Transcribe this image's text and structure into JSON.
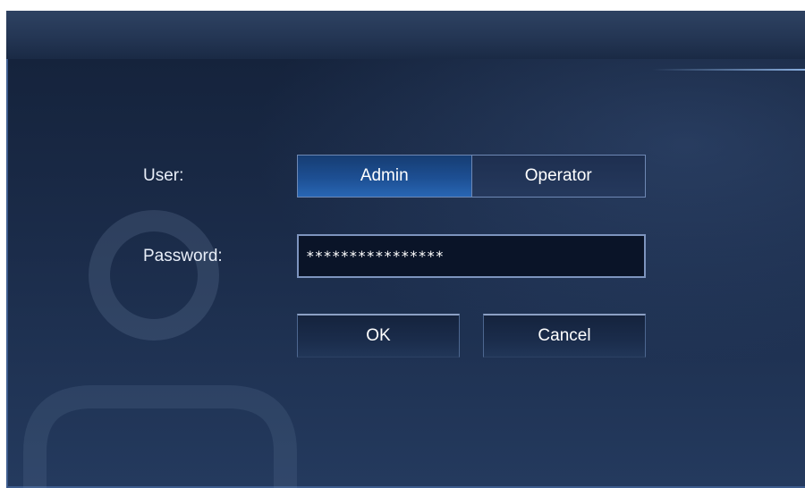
{
  "window": {
    "title": ""
  },
  "login": {
    "user_label": "User:",
    "password_label": "Password:",
    "user_options": [
      "Admin",
      "Operator"
    ],
    "selected_user": "Admin",
    "password_value": "****************",
    "ok_label": "OK",
    "cancel_label": "Cancel"
  },
  "colors": {
    "selected_segment": "#1d4f93",
    "panel_background": "#1b2c4a",
    "border_accent": "#7d94be"
  },
  "icons": {
    "watermark": "user-silhouette-icon"
  }
}
